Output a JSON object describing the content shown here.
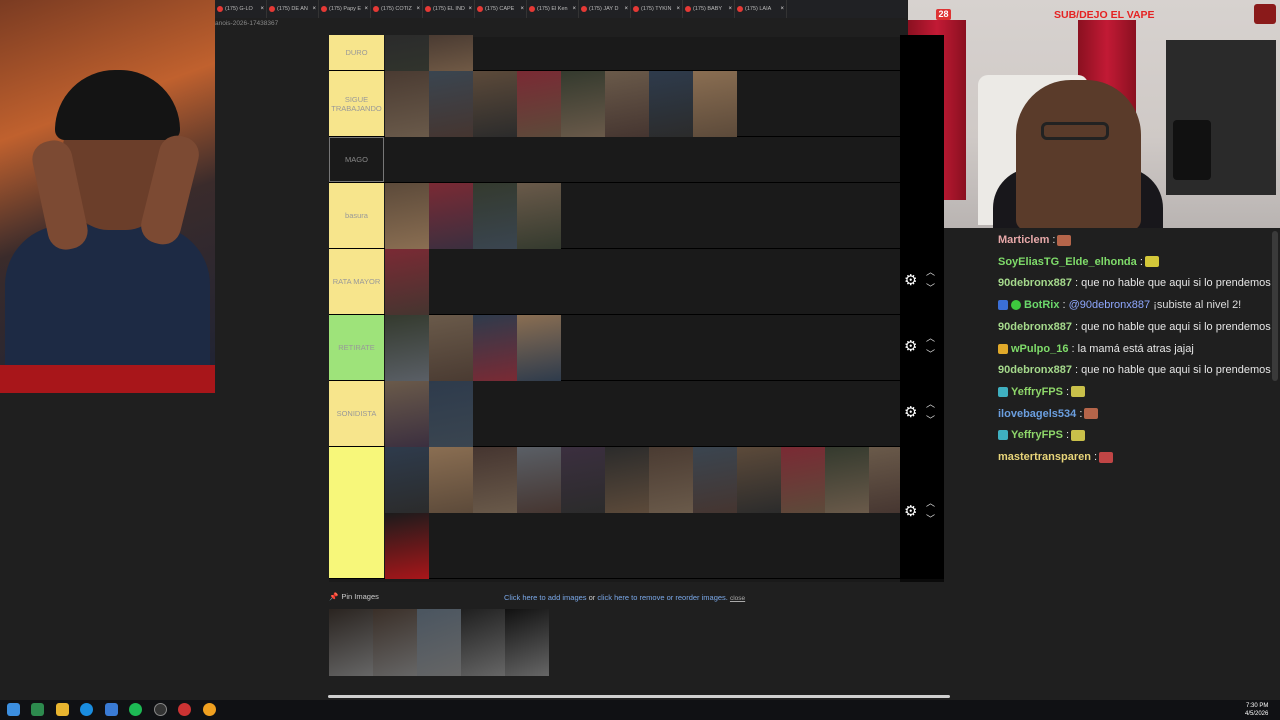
{
  "browser": {
    "tabs": [
      {
        "title": "(175) G-LO"
      },
      {
        "title": "(175) DE AN"
      },
      {
        "title": "(175) Papy E"
      },
      {
        "title": "(175) COTIZ"
      },
      {
        "title": "(175) EL IND"
      },
      {
        "title": "(175) CAPE"
      },
      {
        "title": "(175) El Ken"
      },
      {
        "title": "(175) JAY D"
      },
      {
        "title": "(175) TYKIN"
      },
      {
        "title": "(175) BABY"
      },
      {
        "title": "(175) LAIA"
      }
    ],
    "url_fragment": "anois-2026-17438367"
  },
  "tierlist": {
    "tiers": [
      {
        "label": "DURO",
        "color": "#f7e58c",
        "image_count": 2
      },
      {
        "label": "SIGUE TRABAJANDO",
        "color": "#f7e58c",
        "image_count": 8
      },
      {
        "label": "MAGO",
        "color": "#1a1a1a",
        "image_count": 0
      },
      {
        "label": "basura",
        "color": "#f7e58c",
        "image_count": 4
      },
      {
        "label": "RATA MAYOR",
        "color": "#f7e58c",
        "image_count": 1
      },
      {
        "label": "RETIRATE",
        "color": "#9ee37a",
        "image_count": 4
      },
      {
        "label": "SONIDISTA",
        "color": "#f7e58c",
        "image_count": 2
      },
      {
        "label": "",
        "color": "#f7f77a",
        "image_count": 12
      }
    ]
  },
  "pin": {
    "label": "Pin Images",
    "add_text": "Click here to add images",
    "or_text": "or",
    "reorder_text": "click here to remove or reorder images.",
    "close_text": "close"
  },
  "stream": {
    "badge_count": "28",
    "title": "SUB/DEJO EL VAPE"
  },
  "chat": [
    {
      "user": "Marticlem",
      "color": "#e6a8a8",
      "text": ":",
      "emote": "#b5654a"
    },
    {
      "user": "SoyEliasTG_Elde_elhonda",
      "color": "#7fdc6a",
      "text": ":",
      "emote": "#d4c83a"
    },
    {
      "user": "90debronx887",
      "color": "#a5d98c",
      "text": ": que no hable que aqui si lo prendemos",
      "emote": ""
    },
    {
      "user": "BotRix",
      "color": "#6cd96c",
      "text": ": @90debronx887 ¡subiste al nivel 2!",
      "mention": "@90debronx887",
      "rest": " ¡subiste al nivel 2!",
      "emote": ""
    },
    {
      "user": "90debronx887",
      "color": "#a5d98c",
      "text": ": que no hable que aqui si lo prendemos",
      "emote": ""
    },
    {
      "user": "wPulpo_16",
      "color": "#7fdc6a",
      "text": ": la mamá está atras jajaj",
      "emote": ""
    },
    {
      "user": "90debronx887",
      "color": "#a5d98c",
      "text": ": que no hable que aqui si lo prendemos",
      "emote": ""
    },
    {
      "user": "YeffryFPS",
      "color": "#8ed66a",
      "text": ":",
      "emote": "#c9c04a"
    },
    {
      "user": "ilovebagels534",
      "color": "#6b9fe0",
      "text": ":",
      "emote": "#b5654a"
    },
    {
      "user": "YeffryFPS",
      "color": "#8ed66a",
      "text": ":",
      "emote": "#c9c04a"
    },
    {
      "user": "mastertransparen",
      "color": "#e8d57a",
      "text": ":",
      "emote": "#c04545"
    }
  ],
  "taskbar": {
    "time": "7:30 PM",
    "date": "4/5/2026"
  }
}
